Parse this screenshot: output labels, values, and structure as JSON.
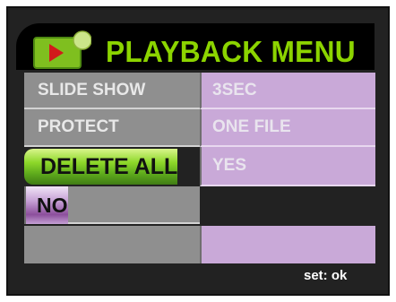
{
  "menu": {
    "title": "PLAYBACK MENU",
    "icon": "playback-icon",
    "accent_color": "#8cd400",
    "rows": [
      {
        "label": "SLIDE SHOW",
        "value": "3SEC"
      },
      {
        "label": "PROTECT",
        "value": "ONE FILE"
      },
      {
        "label": "DELETE ALL",
        "value": "YES"
      },
      {
        "label": "",
        "value": "NO"
      },
      {
        "label": "",
        "value": ""
      }
    ],
    "selected_label": "DELETE ALL",
    "selected_value": "NO"
  },
  "footer": {
    "hint": "set: ok"
  }
}
